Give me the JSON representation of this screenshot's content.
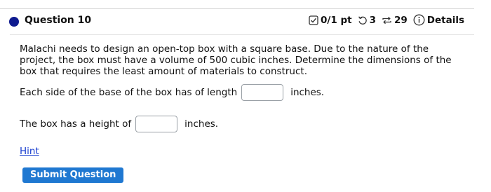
{
  "question": {
    "title": "Question 10"
  },
  "meta": {
    "score": "0/1 pt",
    "retries": "3",
    "submissions": "29",
    "details_label": "Details"
  },
  "problem": {
    "text": "Malachi needs to design an open-top box with a square base. Due to the nature of the project, the box must have a volume of 500 cubic inches. Determine the dimensions of the box that requires the least amount of materials to construct."
  },
  "answers": [
    {
      "prompt": "Each side of the base of the box has of length",
      "unit": "inches.",
      "value": ""
    },
    {
      "prompt": "The box has a height of",
      "unit": "inches.",
      "value": ""
    }
  ],
  "hint_label": "Hint",
  "submit_label": "Submit Question",
  "colors": {
    "dot": "#0e1a8f",
    "submit_bg": "#1f78d1",
    "hint_link": "#1a3fd0"
  }
}
